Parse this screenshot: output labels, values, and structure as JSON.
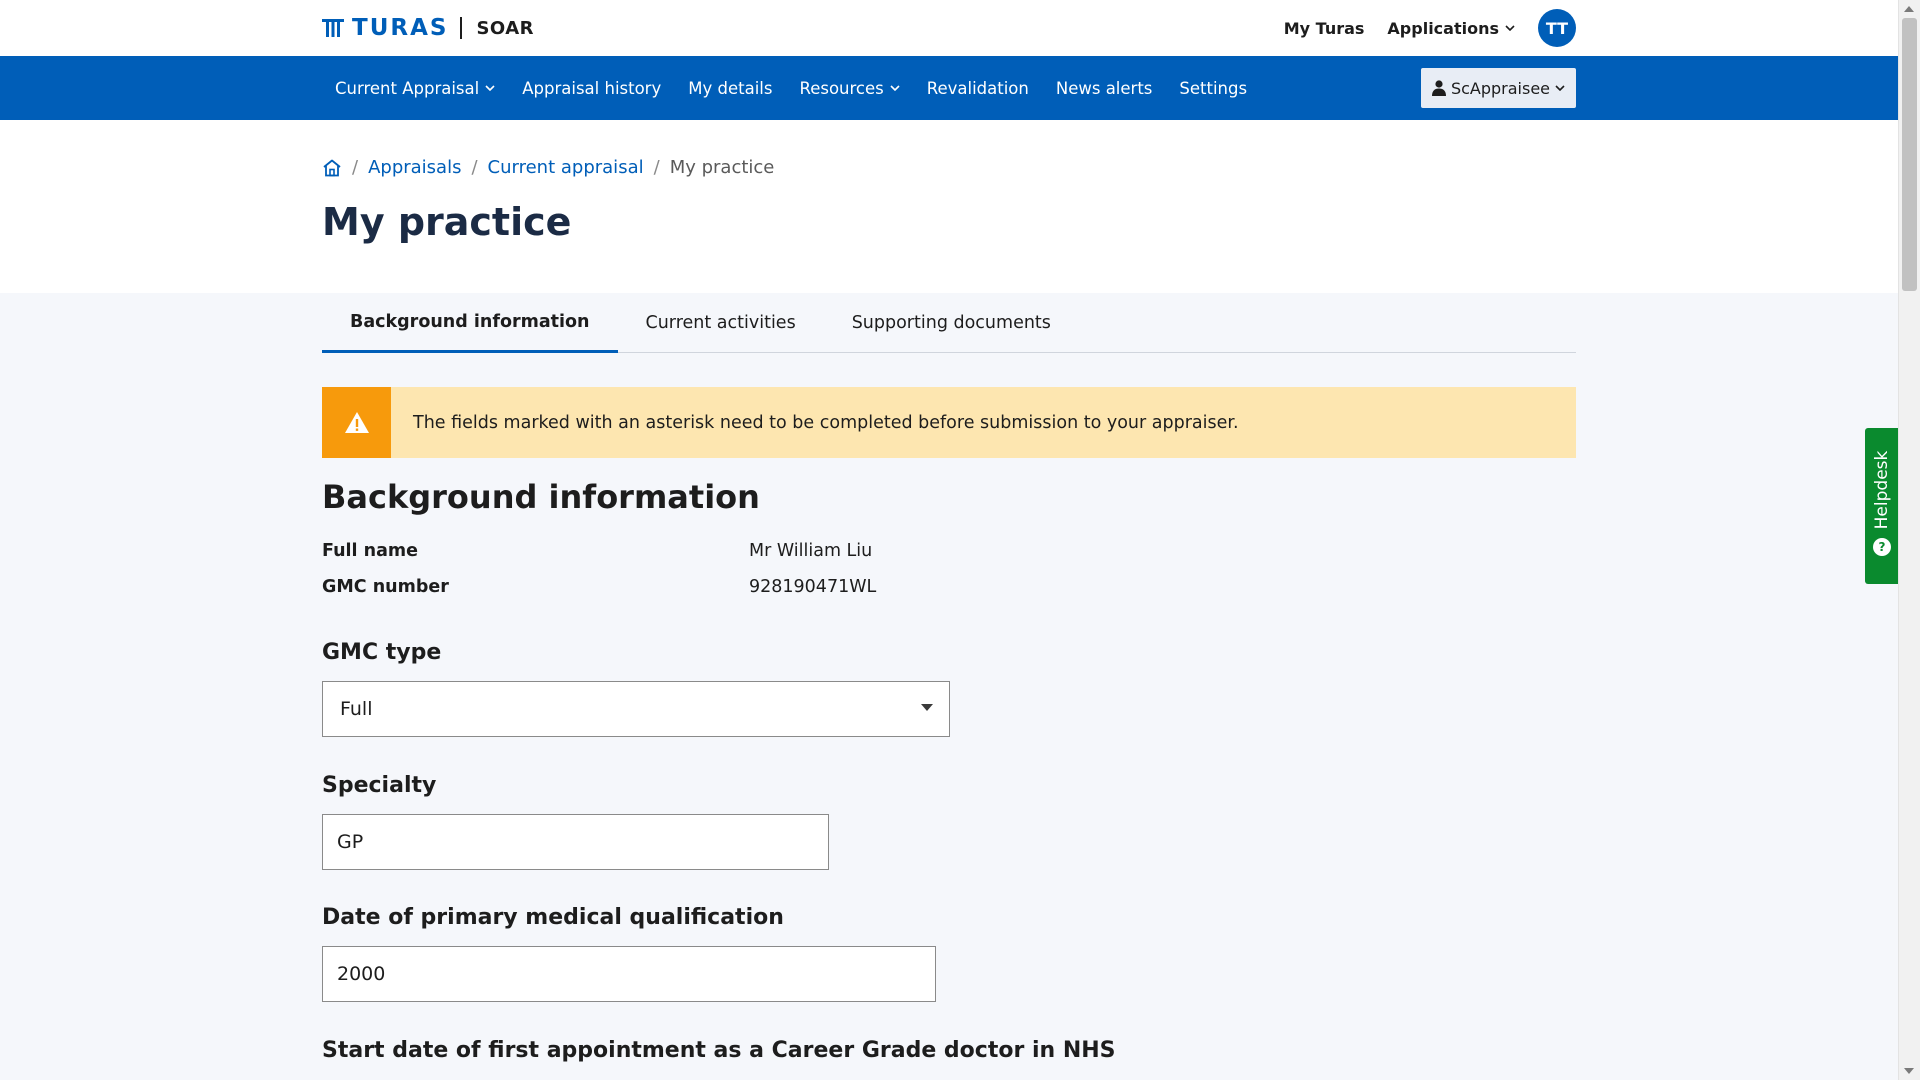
{
  "brand": {
    "name": "TURAS",
    "app": "SOAR"
  },
  "top_links": {
    "my_turas": "My Turas",
    "applications": "Applications",
    "avatar_initials": "TT"
  },
  "nav": {
    "items": [
      {
        "label": "Current Appraisal",
        "has_dropdown": true
      },
      {
        "label": "Appraisal history",
        "has_dropdown": false
      },
      {
        "label": "My details",
        "has_dropdown": false
      },
      {
        "label": "Resources",
        "has_dropdown": true
      },
      {
        "label": "Revalidation",
        "has_dropdown": false
      },
      {
        "label": "News alerts",
        "has_dropdown": false
      },
      {
        "label": "Settings",
        "has_dropdown": false
      }
    ],
    "user": "ScAppraisee"
  },
  "breadcrumb": {
    "home_icon": "home-icon",
    "items": [
      "Appraisals",
      "Current appraisal"
    ],
    "current": "My practice"
  },
  "page": {
    "title": "My practice"
  },
  "tabs": [
    {
      "label": "Background information",
      "active": true
    },
    {
      "label": "Current activities",
      "active": false
    },
    {
      "label": "Supporting documents",
      "active": false
    }
  ],
  "warning": {
    "icon": "warning-icon",
    "text": "The fields marked with an asterisk need to be completed before submission to your appraiser."
  },
  "background": {
    "title": "Background information",
    "full_name_label": "Full name",
    "full_name_value": "Mr William Liu",
    "gmc_number_label": "GMC number",
    "gmc_number_value": "928190471WL"
  },
  "form": {
    "gmc_type_label": "GMC type",
    "gmc_type_value": "Full",
    "specialty_label": "Specialty",
    "specialty_value": "GP",
    "qualification_date_label": "Date of primary medical qualification",
    "qualification_date_value": "2000",
    "career_grade_label": "Start date of first appointment as a Career Grade doctor in NHS"
  },
  "helpdesk": {
    "label": "Helpdesk",
    "icon": "question-icon"
  },
  "colors": {
    "primary": "#005eb8",
    "warning_bg": "#fde6b0",
    "warning_icon_bg": "#f79a0c",
    "helpdesk": "#0a8a2e"
  }
}
